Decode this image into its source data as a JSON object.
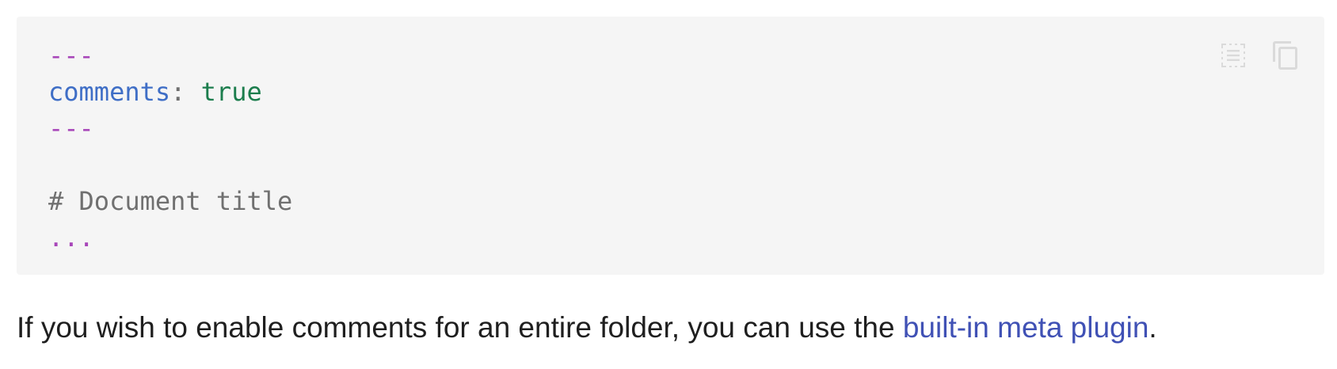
{
  "code_block": {
    "lines": [
      {
        "punct": "---"
      },
      {
        "key": "comments",
        "colon": ":",
        "value": " true"
      },
      {
        "punct": "---"
      },
      {
        "blank": ""
      },
      {
        "heading": "# Document title"
      },
      {
        "ellipsis": "..."
      }
    ],
    "actions": [
      {
        "name": "select-lines",
        "icon": "select-lines-icon"
      },
      {
        "name": "copy",
        "icon": "copy-icon"
      }
    ]
  },
  "paragraph": {
    "text_before": "If you wish to enable comments for an entire folder, you can use the ",
    "link_text": "built-in meta plugin",
    "text_after": "."
  },
  "colors": {
    "code_bg": "#f5f5f5",
    "punct": "#a846b9",
    "key": "#3f6ec6",
    "bool": "#1c7d4d",
    "heading": "#707070",
    "link": "#4051b5"
  }
}
